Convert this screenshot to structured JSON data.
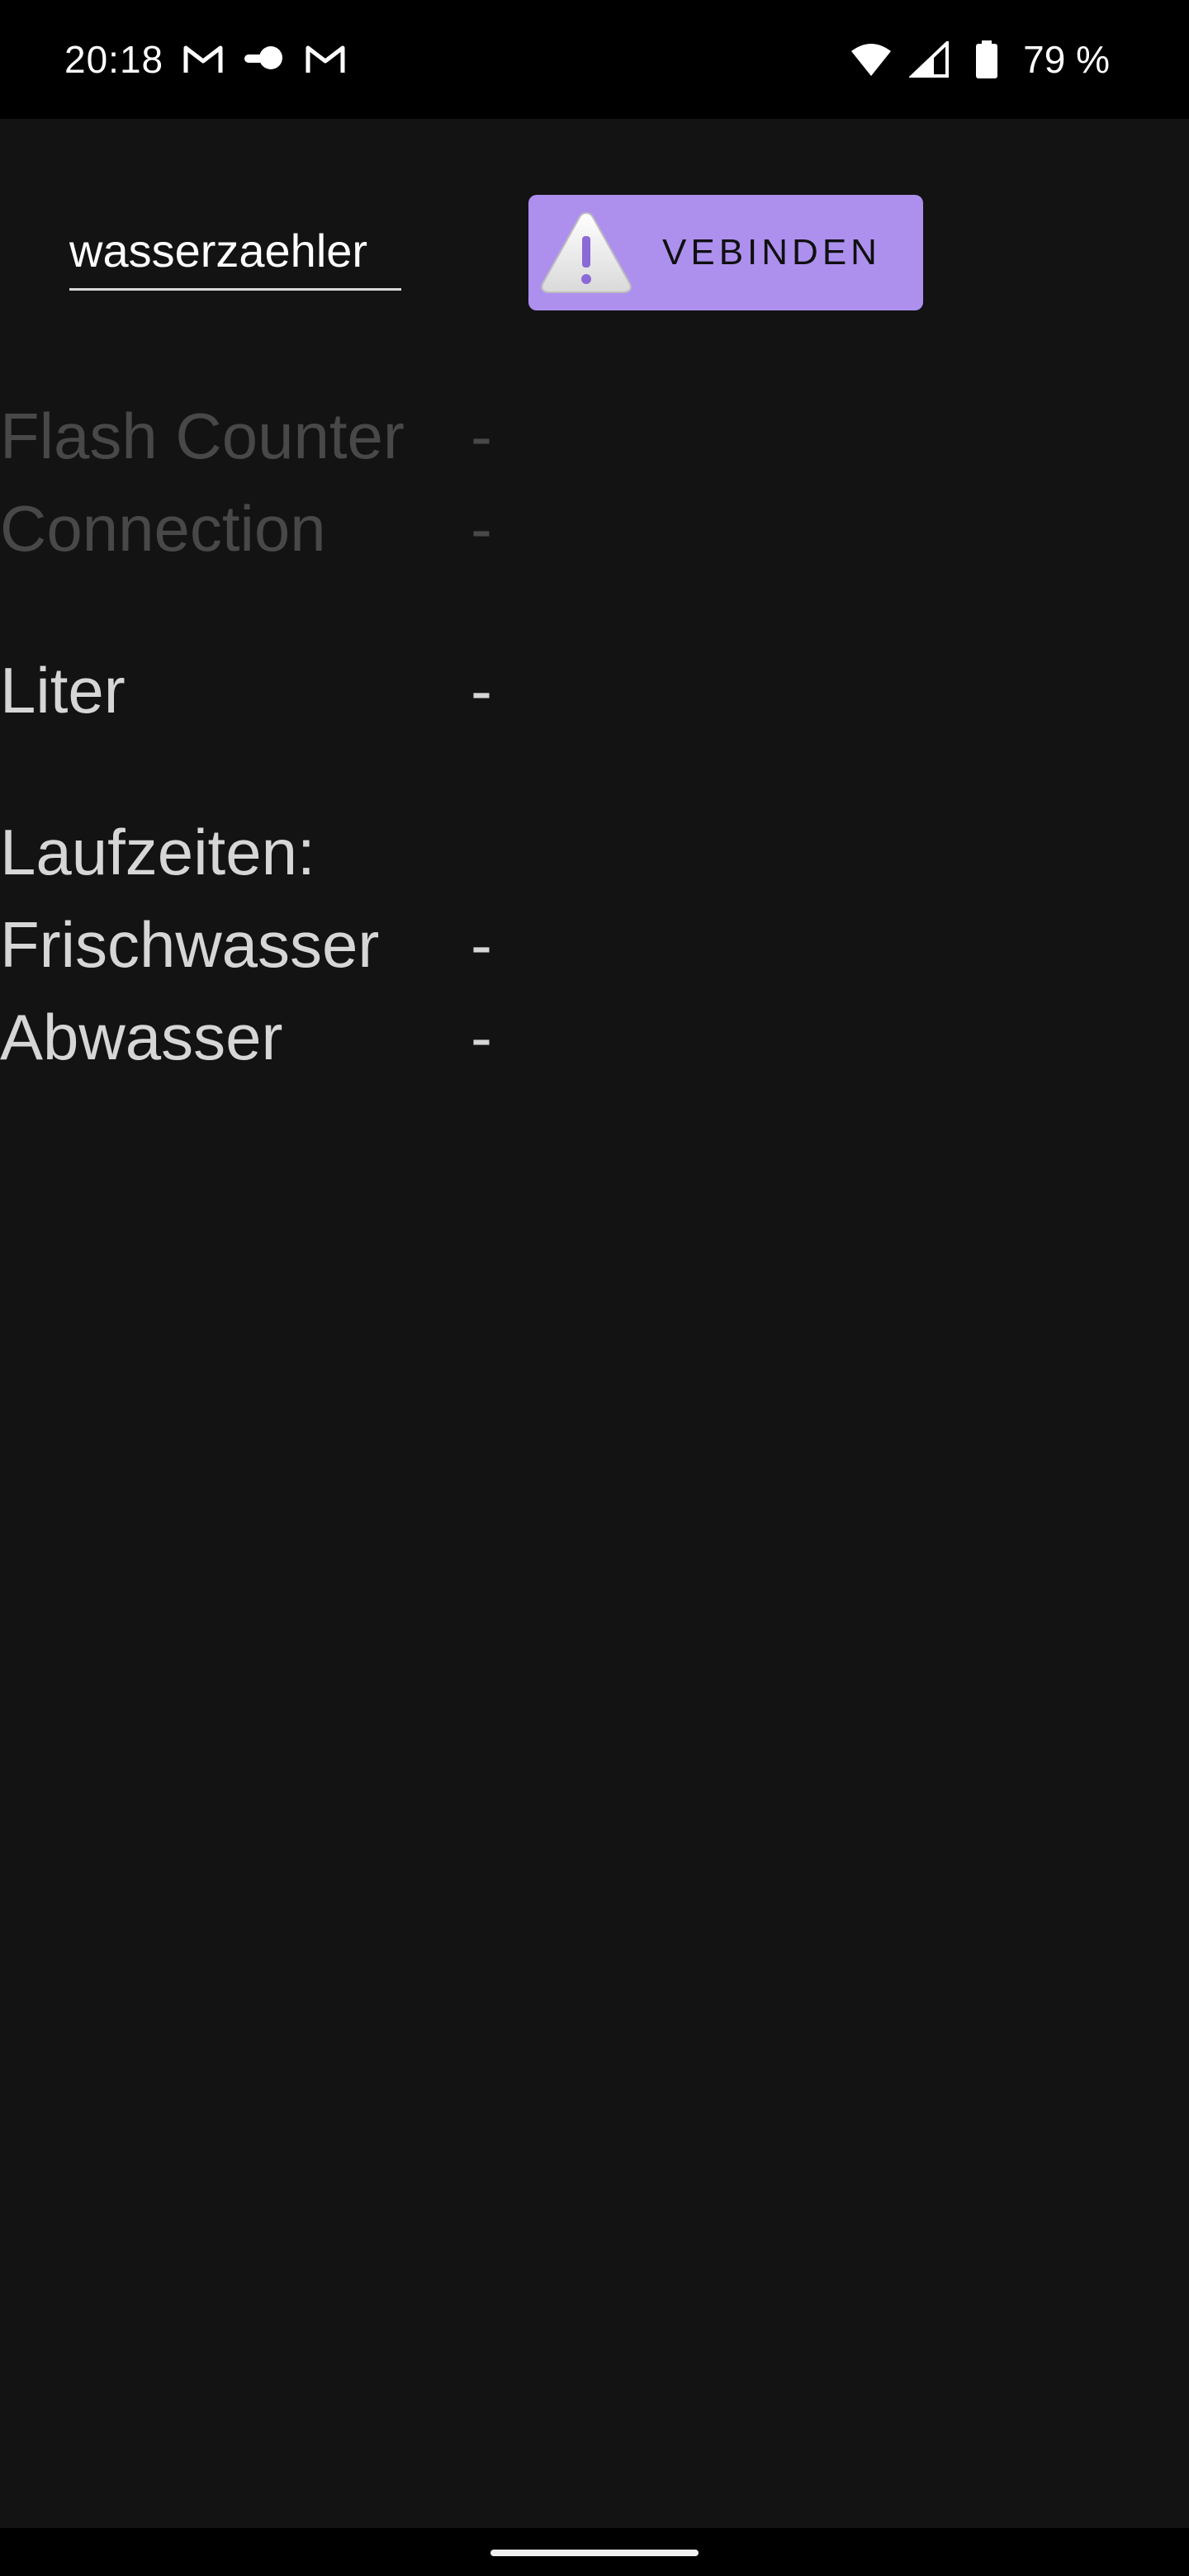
{
  "status_bar": {
    "time": "20:18",
    "left_icons": [
      "gmail-icon",
      "cloud-icon",
      "gmail-icon"
    ],
    "right_icons": [
      "wifi-icon",
      "signal-icon",
      "battery-icon"
    ],
    "battery": "79 %"
  },
  "controls": {
    "host_value": "wasserzaehler",
    "connect_label": "VEBINDEN",
    "connect_icon": "warning-icon",
    "accent_color": "#ad90ee"
  },
  "info": {
    "flash_counter_label": "Flash Counter",
    "flash_counter_value": "-",
    "connection_label": "Connection",
    "connection_value": "-",
    "liter_label": "Liter",
    "liter_value": "-",
    "runtimes_heading": "Laufzeiten:",
    "fresh_label": "Frischwasser",
    "fresh_value": "-",
    "waste_label": "Abwasser",
    "waste_value": "-"
  }
}
